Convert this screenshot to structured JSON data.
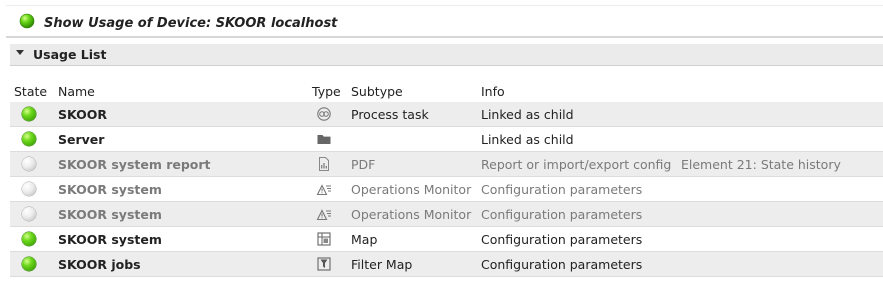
{
  "window": {
    "title": "Show Usage of Device: SKOOR localhost",
    "status": "green"
  },
  "section": {
    "label": "Usage List",
    "expanded": true
  },
  "columns": {
    "state": "State",
    "name": "Name",
    "type": "Type",
    "subtype": "Subtype",
    "info": "Info"
  },
  "rows": [
    {
      "state": "green",
      "name": "SKOOR",
      "type_icon": "process-task-icon",
      "subtype": "Process task",
      "info": "Linked as child",
      "extra": ""
    },
    {
      "state": "green",
      "name": "Server",
      "type_icon": "folder-icon",
      "subtype": "",
      "info": "Linked as child",
      "extra": ""
    },
    {
      "state": "white",
      "name": "SKOOR system report",
      "type_icon": "pdf-report-icon",
      "subtype": "PDF",
      "info": "Report or import/export config",
      "extra": "Element 21: State history"
    },
    {
      "state": "white",
      "name": "SKOOR system",
      "type_icon": "operations-monitor-icon",
      "subtype": "Operations Monitor",
      "info": "Configuration parameters",
      "extra": ""
    },
    {
      "state": "white",
      "name": "SKOOR system",
      "type_icon": "operations-monitor-icon",
      "subtype": "Operations Monitor",
      "info": "Configuration parameters",
      "extra": ""
    },
    {
      "state": "green",
      "name": "SKOOR system",
      "type_icon": "map-icon",
      "subtype": "Map",
      "info": "Configuration parameters",
      "extra": ""
    },
    {
      "state": "green",
      "name": "SKOOR jobs",
      "type_icon": "filter-map-icon",
      "subtype": "Filter Map",
      "info": "Configuration parameters",
      "extra": ""
    }
  ]
}
